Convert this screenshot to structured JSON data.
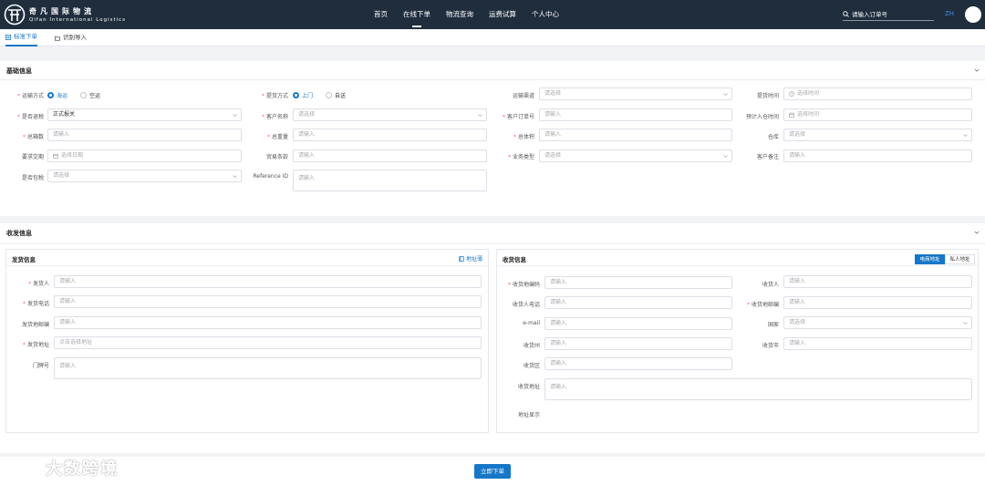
{
  "header": {
    "logo_cn": "奇凡国际物流",
    "logo_en": "Qifan International Logistics",
    "nav": [
      "首页",
      "在线下单",
      "物流查询",
      "运费试算",
      "个人中心"
    ],
    "active_nav": "在线下单",
    "search_placeholder": "请输入订单号",
    "lang": "ZH"
  },
  "tabs": [
    "标准下单",
    "识别导入"
  ],
  "basic": {
    "title": "基础信息",
    "transport_label": "运输方式",
    "transport_options": [
      "海运",
      "空运"
    ],
    "pickup_label": "提货方式",
    "pickup_options": [
      "上门",
      "自送"
    ],
    "channel_label": "运输渠道",
    "channel_placeholder": "请选择",
    "pickup_time_label": "提货时间",
    "pickup_time_placeholder": "选择时间",
    "customs_label": "是否退税",
    "customs_value": "正式报关",
    "customer_label": "客户名称",
    "customer_placeholder": "请选择",
    "order_no_label": "客户订单号",
    "order_no_placeholder": "请输入",
    "eta_label": "预计入仓时间",
    "eta_placeholder": "选择时间",
    "boxes_label": "总箱数",
    "boxes_placeholder": "请输入",
    "weight_label": "总重量",
    "weight_placeholder": "请输入",
    "volume_label": "总体积",
    "volume_placeholder": "请输入",
    "warehouse_label": "仓库",
    "warehouse_placeholder": "请选择",
    "deadline_label": "要求交期",
    "deadline_placeholder": "选择日期",
    "trade_label": "贸易条款",
    "trade_placeholder": "请输入",
    "biz_label": "业务类型",
    "biz_placeholder": "请选择",
    "remark_label": "客户备注",
    "remark_placeholder": "请输入",
    "tax_label": "是否包税",
    "tax_placeholder": "请选择",
    "ref_label": "Reference ID",
    "ref_placeholder": "请输入"
  },
  "shipping": {
    "title": "收发信息",
    "sender": {
      "title": "发货信息",
      "address_book": "地址薄",
      "name_label": "发货人",
      "name_placeholder": "请输入",
      "phone_label": "发货电话",
      "phone_placeholder": "请输入",
      "zip_label": "发货地邮编",
      "zip_placeholder": "请输入",
      "addr_label": "发货地址",
      "addr_placeholder": "点击选择地址",
      "door_label": "门牌号",
      "door_placeholder": "请输入"
    },
    "receiver": {
      "title": "收货信息",
      "seg": [
        "电商地址",
        "私人地址"
      ],
      "code_label": "收货地编码",
      "code_placeholder": "请输入",
      "name_label": "收货人",
      "name_placeholder": "请输入",
      "phone_label": "收货人电话",
      "phone_placeholder": "请输入",
      "zip_label": "收货地邮编",
      "zip_placeholder": "请输入",
      "email_label": "e-mail",
      "email_placeholder": "请输入",
      "country_label": "国家",
      "country_placeholder": "请选择",
      "state_label": "收货州",
      "state_placeholder": "请输入",
      "city_label": "收货市",
      "city_placeholder": "请输入",
      "district_label": "收货区",
      "district_placeholder": "请输入",
      "addr_label": "收货地址",
      "addr_placeholder": "请输入",
      "display_label": "地址显示"
    }
  },
  "submit": "立即下单",
  "watermark": "大数跨境"
}
